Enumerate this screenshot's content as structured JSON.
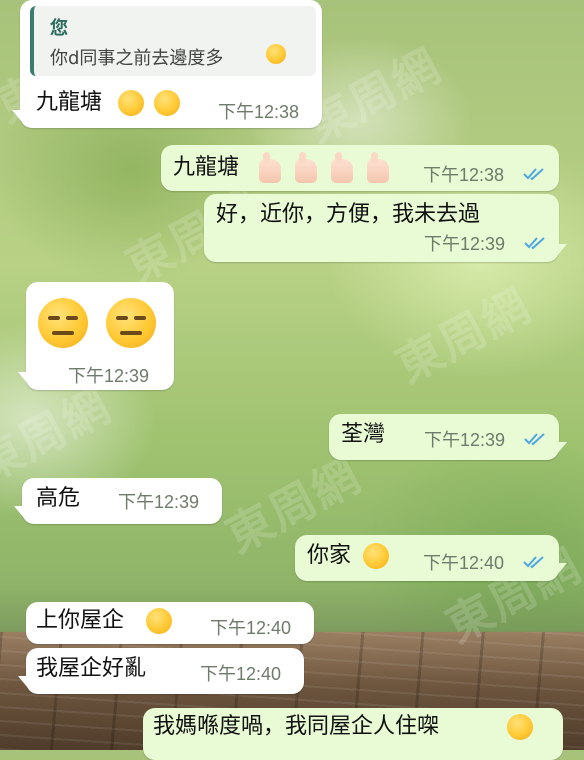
{
  "watermark": "東周網",
  "messages": [
    {
      "direction": "incoming",
      "quote": {
        "name": "您",
        "text": "你d同事之前去邊度多"
      },
      "text": "九龍塘",
      "emojis": [
        "rolling-laughing-emoji",
        "rolling-laughing-emoji"
      ],
      "time": "下午12:38"
    },
    {
      "direction": "outgoing",
      "text": "九龍塘",
      "emojis": [
        "thumbs-up-emoji",
        "thumbs-up-emoji",
        "thumbs-up-emoji",
        "thumbs-up-emoji"
      ],
      "time": "下午12:38",
      "status": "read"
    },
    {
      "direction": "outgoing",
      "text": "好，近你，方便，我未去過",
      "time": "下午12:39",
      "status": "read"
    },
    {
      "direction": "incoming",
      "text": "",
      "emojis": [
        "expressionless-emoji",
        "expressionless-emoji"
      ],
      "time": "下午12:39"
    },
    {
      "direction": "outgoing",
      "text": "荃灣",
      "time": "下午12:39",
      "status": "read"
    },
    {
      "direction": "incoming",
      "text": "高危",
      "time": "下午12:39"
    },
    {
      "direction": "outgoing",
      "text": "你家",
      "emojis": [
        "monocle-face-emoji"
      ],
      "time": "下午12:40",
      "status": "read"
    },
    {
      "direction": "incoming",
      "text": "上你屋企",
      "emojis": [
        "rolling-laughing-emoji"
      ],
      "time": "下午12:40"
    },
    {
      "direction": "incoming",
      "text": "我屋企好亂",
      "time": "下午12:40"
    },
    {
      "direction": "outgoing",
      "text": "我媽喺度喎，我同屋企人住㗎",
      "emojis": [
        "grinning-sweat-emoji"
      ],
      "time": ""
    }
  ],
  "colors": {
    "incoming_bubble": "#ffffff",
    "outgoing_bubble": "#e8fbd4",
    "read_ticks": "#4fa7e0",
    "timestamp": "#6f7b6a",
    "quote_accent": "#3a7d6e"
  }
}
